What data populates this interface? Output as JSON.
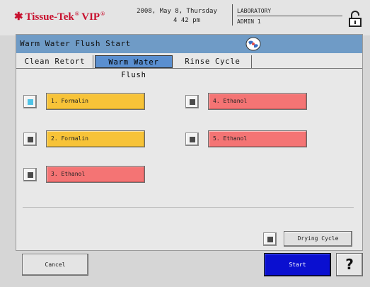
{
  "header": {
    "brand": "Tissue-Tek",
    "brand_mark": "®",
    "brand_suffix": "VIP",
    "date_line": "2008, May 8, Thursday",
    "time_line": "4 42 pm",
    "location": "LABORATORY",
    "user": "ADMIN 1",
    "lock_icon": "unlock-icon"
  },
  "title": {
    "text": "Warm Water Flush Start",
    "icon": "globe-icon"
  },
  "tabs": [
    {
      "label": "Clean Retort",
      "active": false
    },
    {
      "label": "Warm Water Flush",
      "active": true
    },
    {
      "label": "Rinse Cycle",
      "active": false
    }
  ],
  "stations": [
    {
      "label": "1. Formalin",
      "color": "#f7c338",
      "selected": true
    },
    {
      "label": "2. Formalin",
      "color": "#f7c338",
      "selected": false
    },
    {
      "label": "3. Ethanol",
      "color": "#f47474",
      "selected": false
    },
    {
      "label": "4. Ethanol",
      "color": "#f47474",
      "selected": false
    },
    {
      "label": "5. Ethanol",
      "color": "#f47474",
      "selected": false
    }
  ],
  "drying_cycle": {
    "label": "Drying Cycle",
    "selected": false
  },
  "buttons": {
    "cancel": "Cancel",
    "start": "Start",
    "help": "?"
  },
  "colors": {
    "titlebar": "#6f9bc6",
    "active_tab": "#5a8fd0",
    "start_button": "#0a0fd0",
    "brand_red": "#c8102e"
  }
}
